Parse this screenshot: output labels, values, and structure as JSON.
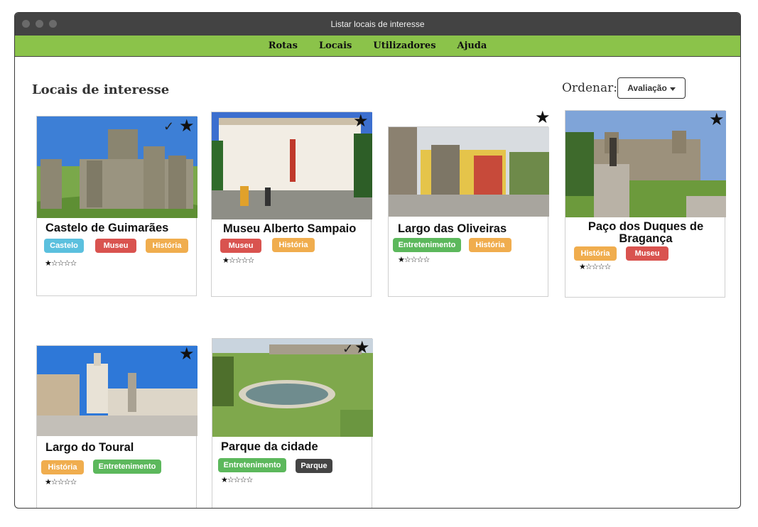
{
  "window": {
    "title": "Listar locais de interesse"
  },
  "nav": {
    "items": [
      "Rotas",
      "Locais",
      "Utilizadores",
      "Ajuda"
    ]
  },
  "page": {
    "title": "Locais de interesse",
    "sort_label": "Ordenar:",
    "sort_value": "Avaliação"
  },
  "icons": {
    "favorite": "star-icon",
    "visited": "checkmark-icon",
    "rating": "rating-stars"
  },
  "colors": {
    "navbar": "#8bc34a",
    "titlebar": "#434343",
    "tag_blue": "#5bc0de",
    "tag_red": "#d9534f",
    "tag_orange": "#f0ad4e",
    "tag_green": "#5cb85c",
    "tag_dark": "#444444"
  },
  "cards": [
    {
      "title": "Castelo de Guimarães",
      "tags": [
        "Castelo",
        "Museu",
        "História"
      ],
      "rating": 1,
      "max_rating": 5,
      "stars": "★☆☆☆☆",
      "favorite": true,
      "visited": true
    },
    {
      "title": "Museu Alberto Sampaio",
      "tags": [
        "Museu",
        "História"
      ],
      "rating": 1,
      "max_rating": 5,
      "stars": "★☆☆☆☆",
      "favorite": true,
      "visited": false
    },
    {
      "title": "Largo das Oliveiras",
      "tags": [
        "Entretenimento",
        "História"
      ],
      "rating": 1,
      "max_rating": 5,
      "stars": "★☆☆☆☆",
      "favorite": true,
      "visited": false
    },
    {
      "title": "Paço dos Duques de Bragança",
      "tags": [
        "História",
        "Museu"
      ],
      "rating": 1,
      "max_rating": 5,
      "stars": "★☆☆☆☆",
      "favorite": true,
      "visited": false
    },
    {
      "title": "Largo do Toural",
      "tags": [
        "História",
        "Entretenimento"
      ],
      "rating": 1,
      "max_rating": 5,
      "stars": "★☆☆☆☆",
      "favorite": true,
      "visited": false
    },
    {
      "title": "Parque da cidade",
      "tags": [
        "Entretenimento",
        "Parque"
      ],
      "rating": 1,
      "max_rating": 5,
      "stars": "★☆☆☆☆",
      "favorite": true,
      "visited": true
    }
  ],
  "glyphs": {
    "star": "★",
    "check": "✓"
  }
}
